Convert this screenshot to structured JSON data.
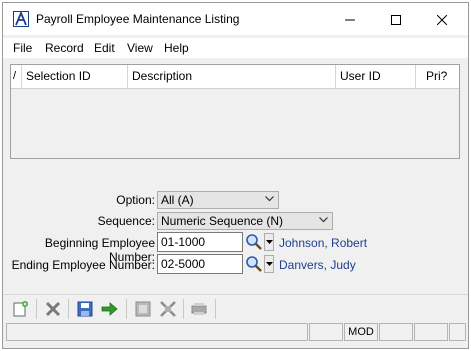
{
  "window": {
    "title": "Payroll Employee Maintenance Listing"
  },
  "menu": {
    "items": [
      "File",
      "Record",
      "Edit",
      "View",
      "Help"
    ]
  },
  "grid": {
    "columns": [
      "/",
      "Selection ID",
      "Description",
      "User ID",
      "Pri?"
    ],
    "rows": []
  },
  "form": {
    "option": {
      "label": "Option:",
      "value": "All (A)"
    },
    "sequence": {
      "label": "Sequence:",
      "value": "Numeric Sequence (N)"
    },
    "beginning": {
      "label": "Beginning Employee Number:",
      "value": "01-1000",
      "name": "Johnson, Robert"
    },
    "ending": {
      "label": "Ending Employee Number:",
      "value": "02-5000",
      "name": "Danvers, Judy"
    }
  },
  "toolbar": {
    "icons": [
      "new-record-icon",
      "delete-icon",
      "save-icon",
      "proceed-arrow-icon",
      "print-icon",
      "cross-arrows-icon",
      "printer-icon"
    ]
  },
  "status": {
    "mode": "MOD"
  },
  "colors": {
    "logo_blue": "#1a3f8a",
    "name_blue": "#1f3f8f",
    "proceed_green": "#2e9a2e"
  }
}
